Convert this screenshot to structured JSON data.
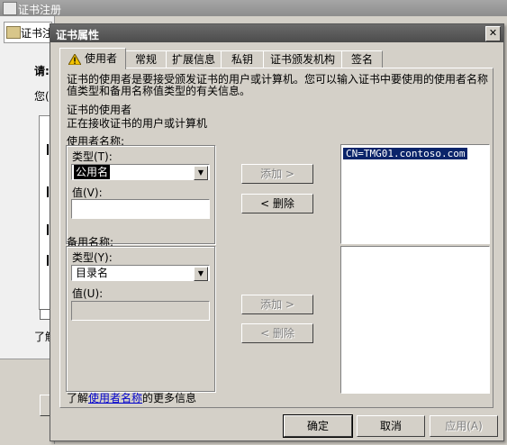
{
  "background_window": {
    "title": "证书注册",
    "tab_label": "证书注",
    "partial_texts": [
      "请:",
      "您(",
      "了解"
    ]
  },
  "dialog": {
    "title": "证书属性",
    "close_label": "✕",
    "tabs": [
      {
        "label": "使用者",
        "warning_icon": true
      },
      {
        "label": "常规"
      },
      {
        "label": "扩展信息"
      },
      {
        "label": "私钥"
      },
      {
        "label": "证书颁发机构"
      },
      {
        "label": "签名"
      }
    ],
    "description_line1": "证书的使用者是要接受颁发证书的用户或计算机。您可以输入证书中要使用的使用者名称",
    "description_line2": "值类型和备用名称值类型的有关信息。",
    "subject_heading": "证书的使用者",
    "subject_sub": "正在接收证书的用户或计算机",
    "subject_name": {
      "group_label": "使用者名称:",
      "type_label": "类型(T):",
      "type_value": "公用名",
      "value_label": "值(V):",
      "value_input": "",
      "add_button": "添加 >",
      "remove_button": "< 删除",
      "list_items": [
        "CN=TMG01.contoso.com"
      ]
    },
    "alt_name": {
      "group_label": "备用名称:",
      "type_label": "类型(Y):",
      "type_value": "目录名",
      "value_label": "值(U):",
      "value_input": "",
      "add_button": "添加 >",
      "remove_button": "< 删除",
      "list_items": []
    },
    "learn_more_prefix": "了解",
    "learn_more_link": "使用者名称",
    "learn_more_suffix": "的更多信息",
    "buttons": {
      "ok": "确定",
      "cancel": "取消",
      "apply": "应用(A)"
    }
  }
}
